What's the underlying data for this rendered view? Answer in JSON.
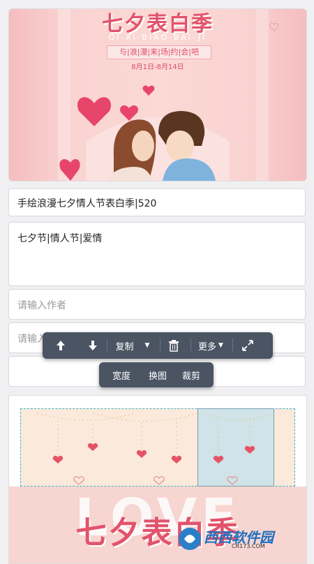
{
  "cover": {
    "title": "七夕表白季",
    "pinyin": "QI-XI-BIAO-BAI-JI",
    "slogan": "与|浪|漫|来|场|约|会|吧",
    "date": "8月1日-8月14日"
  },
  "form": {
    "title_value": "手绘浪漫七夕情人节表白季|520",
    "tags_value": "七夕节|情人节|爱情",
    "author_placeholder": "请输入作者",
    "field4_placeholder": "请输入"
  },
  "toolbar_main": {
    "copy_label": "复制",
    "more_label": "更多"
  },
  "toolbar_image": {
    "width_label": "宽度",
    "replace_label": "换图",
    "crop_label": "裁剪"
  },
  "poster": {
    "big_text": "LOVE",
    "title": "七夕表白季"
  },
  "watermark": {
    "brand": "西西软件园",
    "site": "CR173.COM"
  },
  "colors": {
    "accent_pink": "#e2536b",
    "toolbar_bg": "#4b5463",
    "selection_border": "#3fb6c8"
  }
}
